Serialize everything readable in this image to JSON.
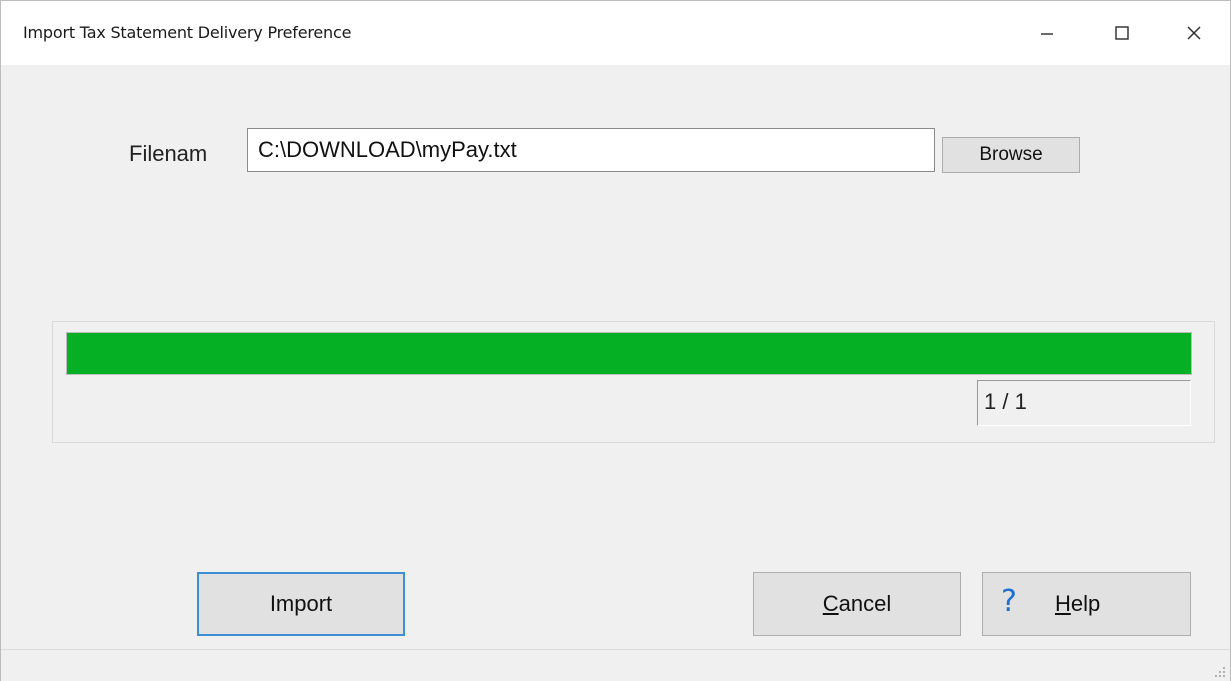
{
  "window": {
    "title": "Import Tax Statement Delivery Preference",
    "controls": {
      "minimize": "minimize-icon",
      "maximize": "maximize-icon",
      "close": "close-icon"
    }
  },
  "file": {
    "label": "Filenam",
    "value": "C:\\DOWNLOAD\\myPay.txt",
    "browse_label": "Browse"
  },
  "progress": {
    "fill_fraction": 1.0,
    "count_text": "1 / 1",
    "fill_color": "#06b025"
  },
  "buttons": {
    "import_label": "Import",
    "cancel_accel": "C",
    "cancel_rest": "ancel",
    "help_icon": "?",
    "help_accel": "H",
    "help_rest": "elp"
  },
  "colors": {
    "focus_border": "#3c8fd6",
    "help_icon": "#1d6fd1"
  }
}
